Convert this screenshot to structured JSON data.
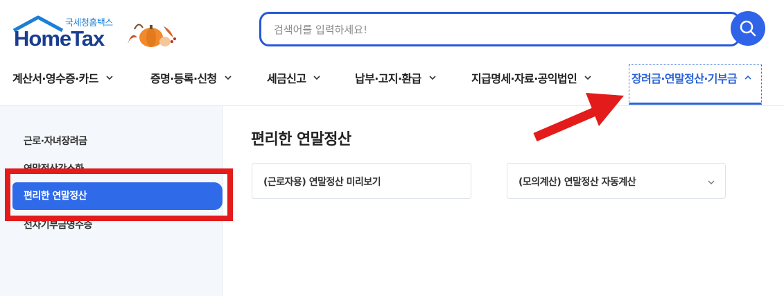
{
  "header": {
    "logo_sub": "국세청홈택스",
    "logo_main": "HomeTax",
    "search": {
      "placeholder": "검색어를 입력하세요!"
    }
  },
  "nav": {
    "items": [
      {
        "label": "계산서·영수증·카드",
        "expanded": false
      },
      {
        "label": "증명·등록·신청",
        "expanded": false
      },
      {
        "label": "세금신고",
        "expanded": false
      },
      {
        "label": "납부·고지·환급",
        "expanded": false
      },
      {
        "label": "지급명세·자료·공익법인",
        "expanded": false
      },
      {
        "label": "장려금·연말정산·기부금",
        "expanded": true
      }
    ]
  },
  "sidebar": {
    "items": [
      {
        "label": "근로·자녀장려금"
      },
      {
        "label": "연말정산간소화"
      },
      {
        "label": "편리한 연말정산",
        "active": true
      },
      {
        "label": "전자기부금영수증"
      }
    ]
  },
  "main": {
    "title": "편리한 연말정산",
    "cards": [
      {
        "label": "(근로자용) 연말정산 미리보기",
        "has_dropdown": false
      },
      {
        "label": "(모의계산) 연말정산 자동계산",
        "has_dropdown": true
      }
    ]
  },
  "colors": {
    "accent": "#2f6ae9",
    "nav_active": "#2a63d8",
    "annotation": "#e31b1b",
    "sidebar_bg": "#f4f7fb"
  },
  "icons": {
    "search": "search-icon",
    "chevron_down": "chevron-down-icon",
    "chevron_up": "chevron-up-icon"
  }
}
